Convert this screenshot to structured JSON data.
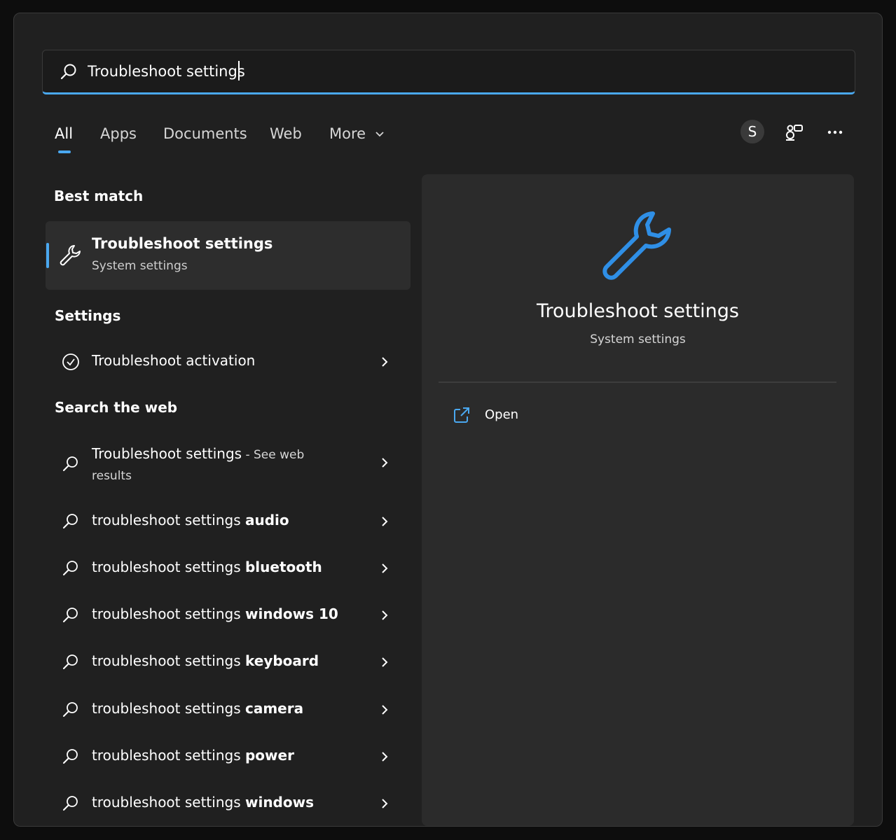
{
  "search": {
    "query": "Troubleshoot settings"
  },
  "tabs": [
    {
      "label": "All"
    },
    {
      "label": "Apps"
    },
    {
      "label": "Documents"
    },
    {
      "label": "Web"
    },
    {
      "label": "More"
    }
  ],
  "account": {
    "initial": "S"
  },
  "best_match": {
    "heading": "Best match",
    "title": "Troubleshoot settings",
    "subtitle": "System settings"
  },
  "settings": {
    "heading": "Settings",
    "items": [
      {
        "label": "Troubleshoot activation"
      }
    ]
  },
  "web": {
    "heading": "Search the web",
    "first": {
      "title": "Troubleshoot settings",
      "suffix": " - See web",
      "suffix2": "results"
    },
    "items": [
      {
        "prefix": "troubleshoot settings ",
        "bold": "audio"
      },
      {
        "prefix": "troubleshoot settings ",
        "bold": "bluetooth"
      },
      {
        "prefix": "troubleshoot settings ",
        "bold": "windows 10"
      },
      {
        "prefix": "troubleshoot settings ",
        "bold": "keyboard"
      },
      {
        "prefix": "troubleshoot settings ",
        "bold": "camera"
      },
      {
        "prefix": "troubleshoot settings ",
        "bold": "power"
      },
      {
        "prefix": "troubleshoot settings ",
        "bold": "windows"
      }
    ]
  },
  "preview": {
    "title": "Troubleshoot settings",
    "subtitle": "System settings",
    "open_label": "Open"
  },
  "colors": {
    "accent": "#4aa8f0",
    "panel": "#202020",
    "preview": "#2b2b2b"
  }
}
